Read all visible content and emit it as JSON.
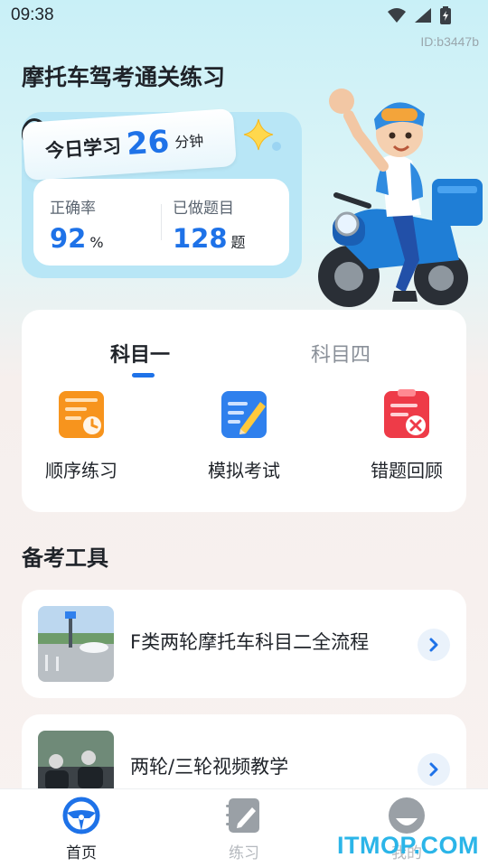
{
  "status_bar": {
    "time": "09:38",
    "device_id": "ID:b3447b"
  },
  "header": {
    "title": "摩托车驾考通关练习"
  },
  "study": {
    "label": "今日学习",
    "minutes": "26",
    "unit": "分钟",
    "accuracy_label": "正确率",
    "accuracy_value": "92",
    "accuracy_unit": "%",
    "done_label": "已做题目",
    "done_value": "128",
    "done_unit": "题"
  },
  "subject": {
    "tabs": [
      {
        "label": "科目一",
        "active": true
      },
      {
        "label": "科目四",
        "active": false
      }
    ],
    "features": [
      {
        "label": "顺序练习",
        "icon": "sequential-practice-icon"
      },
      {
        "label": "模拟考试",
        "icon": "mock-exam-icon"
      },
      {
        "label": "错题回顾",
        "icon": "wrong-questions-icon"
      }
    ]
  },
  "tools": {
    "title": "备考工具",
    "items": [
      {
        "title": "F类两轮摩托车科目二全流程"
      },
      {
        "title": "两轮/三轮视频教学"
      }
    ]
  },
  "nav": {
    "items": [
      {
        "label": "首页",
        "icon": "steering-wheel-icon",
        "active": true
      },
      {
        "label": "练习",
        "icon": "notebook-icon",
        "active": false
      },
      {
        "label": "我的",
        "icon": "profile-icon",
        "active": false
      }
    ]
  },
  "watermark": "ITMOP.COM",
  "colors": {
    "accent": "#1e72e8",
    "header_bg": "#c9f0f7",
    "page_bg": "#f8f2f0"
  }
}
